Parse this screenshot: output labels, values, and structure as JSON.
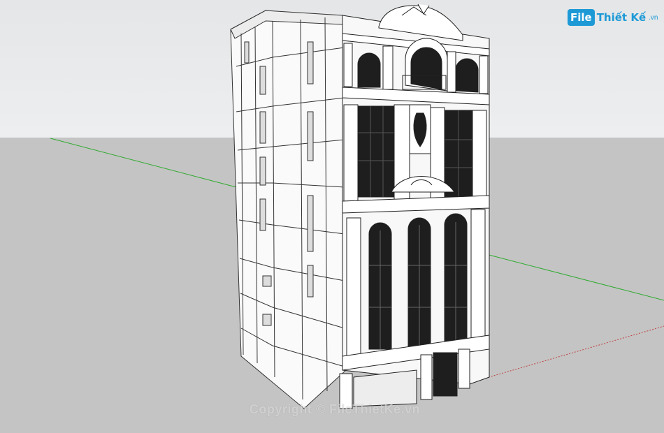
{
  "logo": {
    "badge": "File",
    "text": "Thiết Kế",
    "tld": ".vn"
  },
  "watermark": "Copyright © FileThietKe.vn",
  "model": {
    "description_icon": "building-model-icon",
    "axis_colors": {
      "green_axis": "#2eaa2e",
      "red_axis": "#c04040"
    }
  },
  "colors": {
    "sky": "#e8eaec",
    "ground": "#c4c4c4",
    "wall": "#ffffff",
    "glass": "#1e1e1e",
    "line": "#222222",
    "brand": "#1d9ad6"
  }
}
